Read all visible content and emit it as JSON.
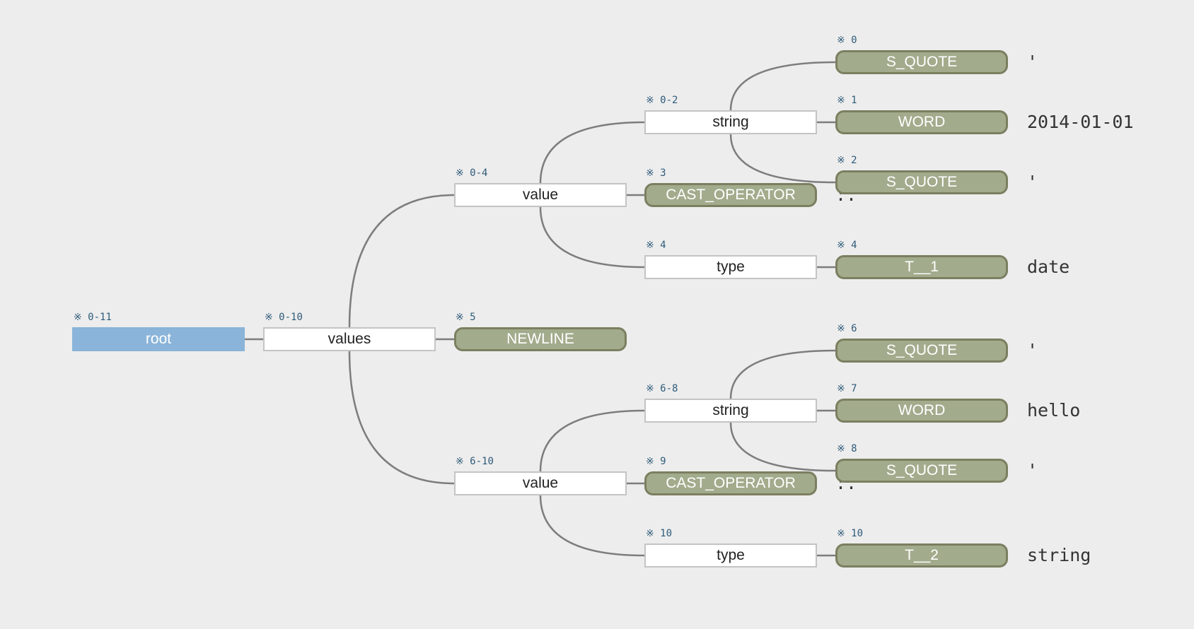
{
  "diagram": {
    "type": "parse-tree",
    "colors": {
      "background": "#ededed",
      "root_fill": "#8ab4d9",
      "rule_fill": "#ffffff",
      "rule_border": "#c4c4c4",
      "token_fill": "#a2ab8c",
      "token_border": "#7b7f60",
      "range_text": "#2e5b7a",
      "edge": "#7d7d7d"
    },
    "range_marker": "※",
    "nodes": [
      {
        "id": "n_root",
        "label": "root",
        "kind": "root",
        "range": "0-11",
        "parent": null
      },
      {
        "id": "n_values",
        "label": "values",
        "kind": "rule",
        "range": "0-10",
        "parent": "n_root"
      },
      {
        "id": "n_value1",
        "label": "value",
        "kind": "rule",
        "range": "0-4",
        "parent": "n_values"
      },
      {
        "id": "n_newline",
        "label": "NEWLINE",
        "kind": "token",
        "range": "5",
        "parent": "n_values",
        "text": ""
      },
      {
        "id": "n_value2",
        "label": "value",
        "kind": "rule",
        "range": "6-10",
        "parent": "n_values"
      },
      {
        "id": "n_string1",
        "label": "string",
        "kind": "rule",
        "range": "0-2",
        "parent": "n_value1"
      },
      {
        "id": "n_cast1",
        "label": "CAST_OPERATOR",
        "kind": "token",
        "range": "3",
        "parent": "n_value1",
        "text": "::"
      },
      {
        "id": "n_type1",
        "label": "type",
        "kind": "rule",
        "range": "4",
        "parent": "n_value1"
      },
      {
        "id": "n_sq0",
        "label": "S_QUOTE",
        "kind": "token",
        "range": "0",
        "parent": "n_string1",
        "text": "'"
      },
      {
        "id": "n_word1",
        "label": "WORD",
        "kind": "token",
        "range": "1",
        "parent": "n_string1",
        "text": "2014-01-01"
      },
      {
        "id": "n_sq2",
        "label": "S_QUOTE",
        "kind": "token",
        "range": "2",
        "parent": "n_string1",
        "text": "'"
      },
      {
        "id": "n_t1",
        "label": "T__1",
        "kind": "token",
        "range": "4",
        "parent": "n_type1",
        "text": "date"
      },
      {
        "id": "n_string2",
        "label": "string",
        "kind": "rule",
        "range": "6-8",
        "parent": "n_value2"
      },
      {
        "id": "n_cast2",
        "label": "CAST_OPERATOR",
        "kind": "token",
        "range": "9",
        "parent": "n_value2",
        "text": "::"
      },
      {
        "id": "n_type2",
        "label": "type",
        "kind": "rule",
        "range": "10",
        "parent": "n_value2"
      },
      {
        "id": "n_sq6",
        "label": "S_QUOTE",
        "kind": "token",
        "range": "6",
        "parent": "n_string2",
        "text": "'"
      },
      {
        "id": "n_word7",
        "label": "WORD",
        "kind": "token",
        "range": "7",
        "parent": "n_string2",
        "text": "hello"
      },
      {
        "id": "n_sq8",
        "label": "S_QUOTE",
        "kind": "token",
        "range": "8",
        "parent": "n_string2",
        "text": "'"
      },
      {
        "id": "n_t2",
        "label": "T__2",
        "kind": "token",
        "range": "10",
        "parent": "n_type2",
        "text": "string"
      }
    ]
  }
}
